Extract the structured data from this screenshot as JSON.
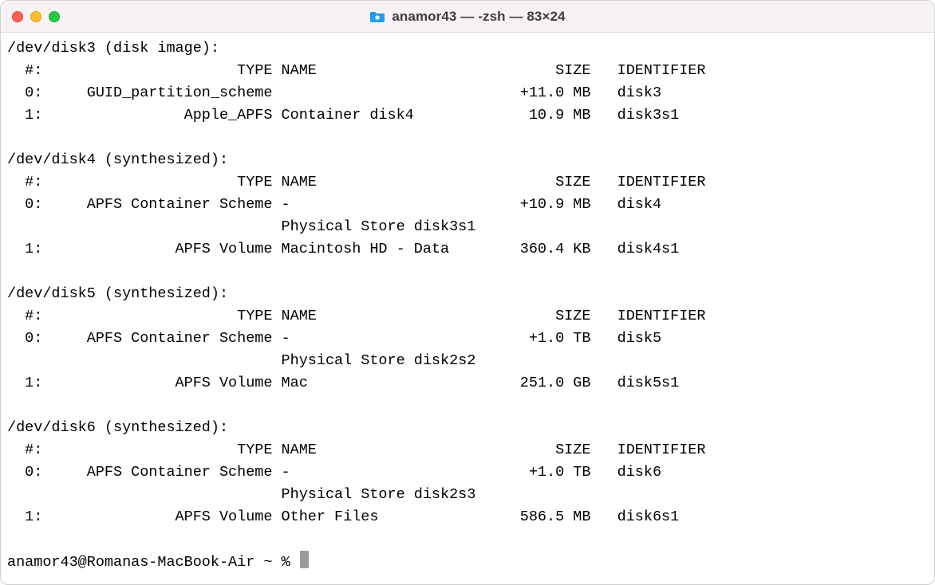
{
  "window": {
    "title": "anamor43 — -zsh — 83×24"
  },
  "terminal": {
    "disks": [
      {
        "header": "/dev/disk3 (disk image):",
        "rows": [
          {
            "idx": "#:",
            "type": "TYPE",
            "name": "NAME",
            "size": "SIZE",
            "identifier": "IDENTIFIER"
          },
          {
            "idx": "0:",
            "type": "GUID_partition_scheme",
            "name": "",
            "size": "+11.0 MB",
            "identifier": "disk3"
          },
          {
            "idx": "1:",
            "type": "Apple_APFS",
            "name": "Container disk4",
            "size": "10.9 MB",
            "identifier": "disk3s1"
          }
        ]
      },
      {
        "header": "/dev/disk4 (synthesized):",
        "rows": [
          {
            "idx": "#:",
            "type": "TYPE",
            "name": "NAME",
            "size": "SIZE",
            "identifier": "IDENTIFIER"
          },
          {
            "idx": "0:",
            "type": "APFS Container Scheme",
            "name": "-",
            "size": "+10.9 MB",
            "identifier": "disk4"
          },
          {
            "idx": "",
            "type": "",
            "name": "Physical Store disk3s1",
            "size": "",
            "identifier": ""
          },
          {
            "idx": "1:",
            "type": "APFS Volume",
            "name": "Macintosh HD - Data",
            "size": "360.4 KB",
            "identifier": "disk4s1"
          }
        ]
      },
      {
        "header": "/dev/disk5 (synthesized):",
        "rows": [
          {
            "idx": "#:",
            "type": "TYPE",
            "name": "NAME",
            "size": "SIZE",
            "identifier": "IDENTIFIER"
          },
          {
            "idx": "0:",
            "type": "APFS Container Scheme",
            "name": "-",
            "size": "+1.0 TB",
            "identifier": "disk5"
          },
          {
            "idx": "",
            "type": "",
            "name": "Physical Store disk2s2",
            "size": "",
            "identifier": ""
          },
          {
            "idx": "1:",
            "type": "APFS Volume",
            "name": "Mac",
            "size": "251.0 GB",
            "identifier": "disk5s1"
          }
        ]
      },
      {
        "header": "/dev/disk6 (synthesized):",
        "rows": [
          {
            "idx": "#:",
            "type": "TYPE",
            "name": "NAME",
            "size": "SIZE",
            "identifier": "IDENTIFIER"
          },
          {
            "idx": "0:",
            "type": "APFS Container Scheme",
            "name": "-",
            "size": "+1.0 TB",
            "identifier": "disk6"
          },
          {
            "idx": "",
            "type": "",
            "name": "Physical Store disk2s3",
            "size": "",
            "identifier": ""
          },
          {
            "idx": "1:",
            "type": "APFS Volume",
            "name": "Other Files",
            "size": "586.5 MB",
            "identifier": "disk6s1"
          }
        ]
      }
    ],
    "prompt": "anamor43@Romanas-MacBook-Air ~ % "
  }
}
